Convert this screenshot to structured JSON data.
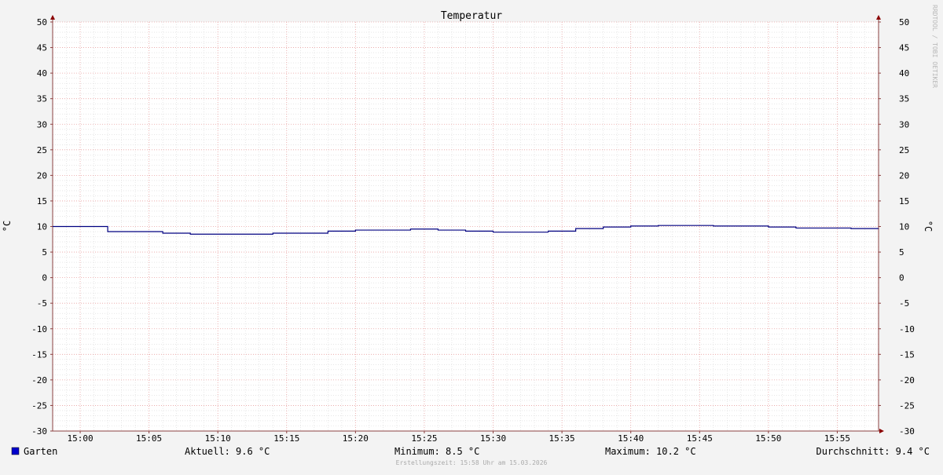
{
  "chart_data": {
    "type": "line",
    "title": "Temperatur",
    "ylabel": "°C",
    "ylabel_right": "°C",
    "watermark": "RRDTOOL / TOBI OETIKER",
    "ylim": [
      -30,
      50
    ],
    "y_ticks": [
      "50",
      "45",
      "40",
      "35",
      "30",
      "25",
      "20",
      "15",
      "10",
      "5",
      "0",
      "-5",
      "-10",
      "-15",
      "-20",
      "-25",
      "-30"
    ],
    "xlim": [
      "14:58",
      "15:58"
    ],
    "x_ticks": [
      "15:00",
      "15:05",
      "15:10",
      "15:15",
      "15:20",
      "15:25",
      "15:30",
      "15:35",
      "15:40",
      "15:45",
      "15:50",
      "15:55"
    ],
    "grid": true,
    "series": [
      {
        "name": "Garten",
        "color": "#000080",
        "legend_color": "#0000cc",
        "points": [
          [
            "14:58",
            10.0
          ],
          [
            "15:02",
            9.0
          ],
          [
            "15:06",
            8.7
          ],
          [
            "15:08",
            8.5
          ],
          [
            "15:12",
            8.5
          ],
          [
            "15:14",
            8.7
          ],
          [
            "15:18",
            9.1
          ],
          [
            "15:20",
            9.3
          ],
          [
            "15:24",
            9.5
          ],
          [
            "15:26",
            9.3
          ],
          [
            "15:28",
            9.1
          ],
          [
            "15:30",
            8.9
          ],
          [
            "15:34",
            9.1
          ],
          [
            "15:36",
            9.6
          ],
          [
            "15:38",
            9.9
          ],
          [
            "15:40",
            10.1
          ],
          [
            "15:42",
            10.2
          ],
          [
            "15:46",
            10.1
          ],
          [
            "15:50",
            9.9
          ],
          [
            "15:52",
            9.7
          ],
          [
            "15:56",
            9.6
          ],
          [
            "15:58",
            9.6
          ]
        ]
      }
    ],
    "legend": {
      "label": "Garten",
      "stats": {
        "current": "Aktuell: 9.6 °C",
        "min": "Minimum: 8.5 °C",
        "max": "Maximum: 10.2 °C",
        "avg": "Durchschnitt: 9.4 °C"
      }
    },
    "footer": "Erstellungszeit: 15:58 Uhr am 15.03.2026",
    "colors": {
      "background": "#f3f3f3",
      "canvas": "#ffffff",
      "minor_grid": "#d8d8d8",
      "major_grid": "#e8a0a0",
      "axis": "#8b4040",
      "arrow": "#8b0000"
    }
  }
}
